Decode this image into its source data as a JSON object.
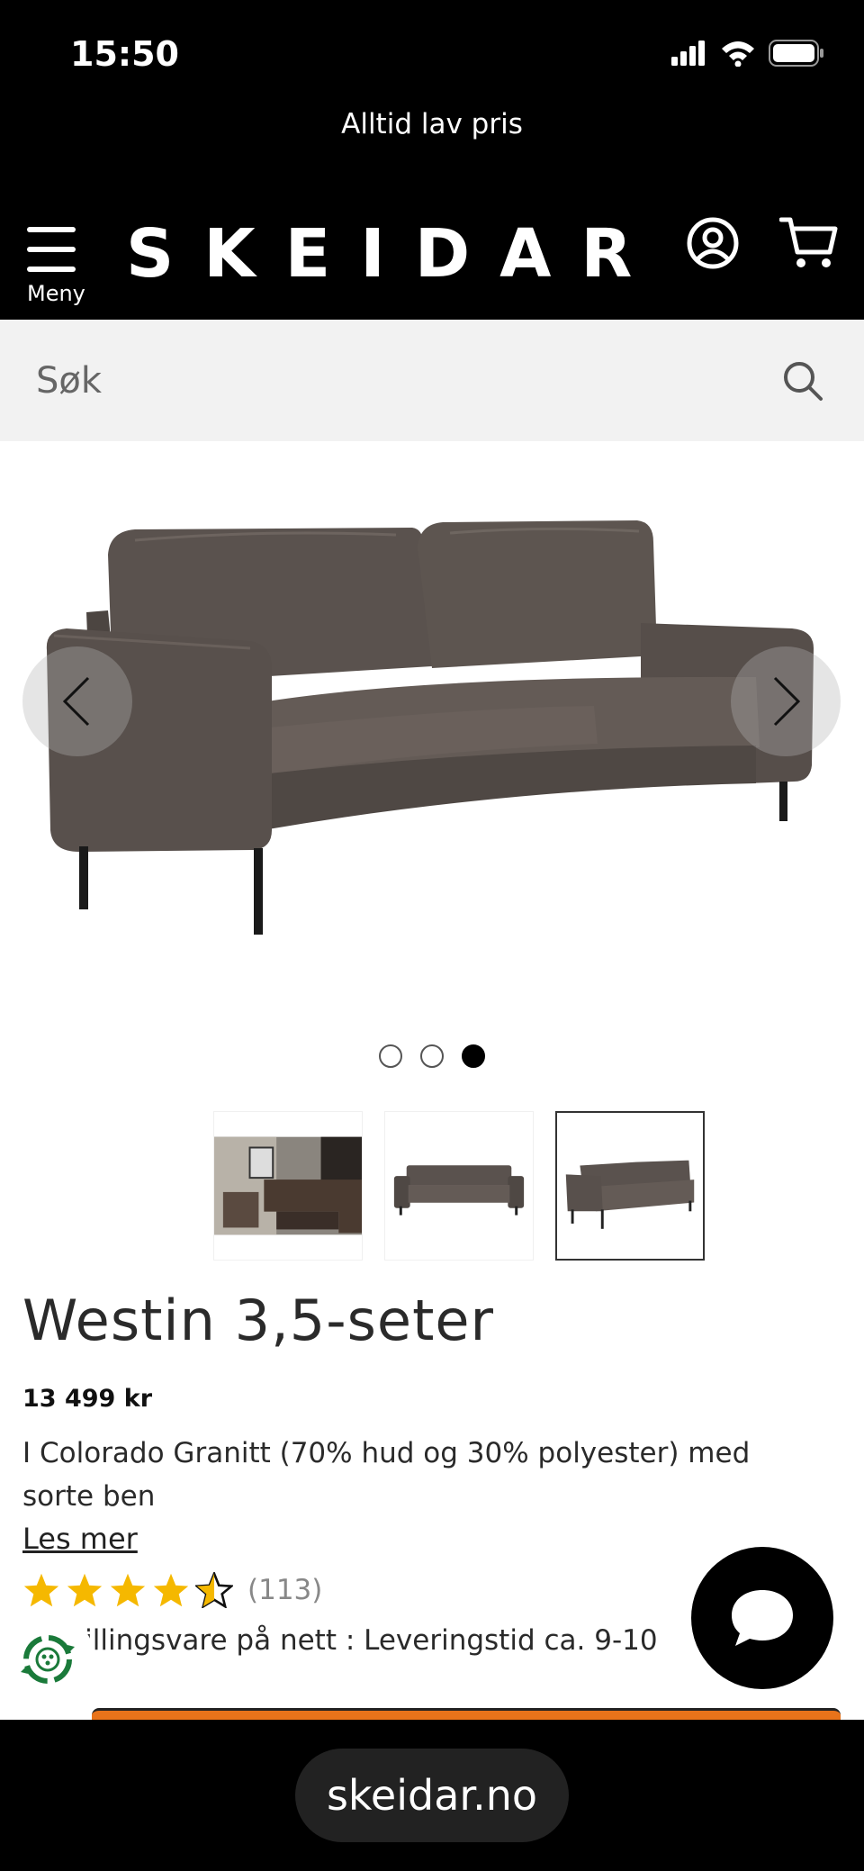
{
  "status_bar": {
    "time": "15:50"
  },
  "promo": {
    "text": "Alltid lav pris"
  },
  "header": {
    "menu_label": "Meny",
    "logo": "SKEIDAR"
  },
  "search": {
    "placeholder": "Søk"
  },
  "carousel": {
    "slide_count": 3,
    "active_slide": 3
  },
  "product": {
    "title": "Westin 3,5-seter",
    "price": "13 499 kr",
    "description": "I Colorado Granitt (70% hud og 30% polyester) med sorte ben",
    "read_more": "Les mer",
    "rating_value": 4.5,
    "rating_max": 5,
    "rating_count": "(113)",
    "delivery": "tillingsvare på nett : Leveringstid ca. 9-10"
  },
  "colors": {
    "star": "#f5b800",
    "cta": "#e8731a",
    "eco": "#1a7a3a"
  },
  "browser": {
    "url": "skeidar.no"
  }
}
